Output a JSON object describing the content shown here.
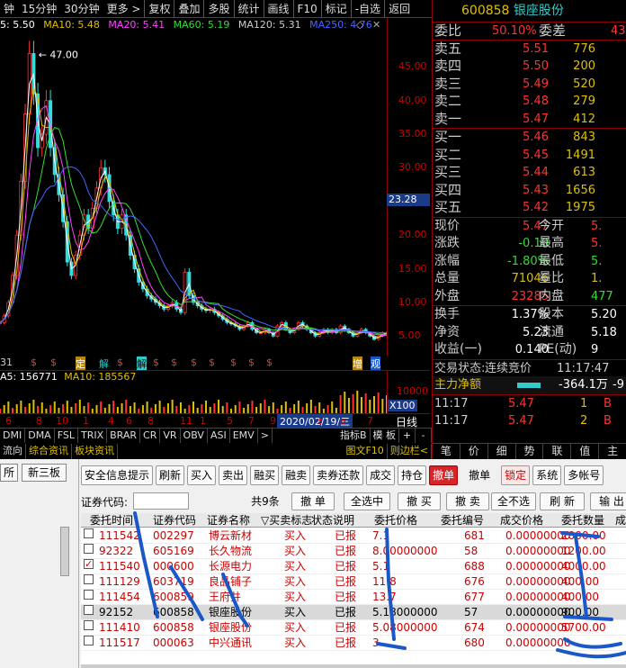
{
  "toolbar": {
    "periods": [
      "钟",
      "15分钟",
      "30分钟",
      "更多 >"
    ],
    "buttons": [
      "复权",
      "叠加",
      "多股",
      "统计",
      "画线",
      "F10",
      "标记",
      "-自选",
      "返回"
    ]
  },
  "ma_legend": {
    "ma5": "5: 5.50",
    "ma10": "MA10: 5.48",
    "ma20": "MA20: 5.41",
    "ma60": "MA60: 5.19",
    "ma120": "MA120: 5.31",
    "ma250": "MA250: 4.76",
    "colors": {
      "ma5": "#ffffff",
      "ma10": "#e0c000",
      "ma20": "#ff44ff",
      "ma60": "#33dd33",
      "ma120": "#cccccc",
      "ma250": "#4466ff"
    }
  },
  "chart_data": {
    "type": "line",
    "series": [
      {
        "values": [
          7,
          8,
          10,
          14,
          20,
          28,
          38,
          47,
          41,
          33,
          35,
          40,
          33,
          29,
          26,
          22,
          16,
          14,
          17,
          20,
          23,
          21,
          24,
          27,
          30,
          29,
          25,
          23,
          21,
          23,
          20,
          17,
          15,
          13,
          12,
          11,
          10.5,
          10,
          9.5,
          9,
          9.5,
          10,
          9,
          8.5,
          14.5,
          11,
          10,
          9.5,
          9,
          8.8,
          9,
          8.5,
          8,
          7.5,
          7,
          6.8,
          6.5,
          6,
          6.5,
          7,
          6,
          5.5,
          5.5,
          6,
          5.5,
          5,
          6.5,
          7,
          6,
          5.5,
          6,
          7,
          6.5,
          6,
          5.5,
          5,
          5.5,
          6,
          5.5,
          6,
          5.5,
          6.5,
          6,
          5.5,
          5,
          5.5,
          6,
          5.5,
          5,
          4.5,
          5,
          5.5,
          5.5
        ]
      }
    ],
    "ylim": [
      2.5,
      50
    ],
    "yticks": [
      "45.00",
      "40.00",
      "35.00",
      "30.00",
      "25.00",
      "20.00",
      "15.00",
      "10.00",
      "5.00"
    ],
    "high_label": "47.00",
    "current": "23.28",
    "grid": false
  },
  "signals": [
    {
      "t": "$",
      "c": "#ff3333"
    },
    {
      "t": "$",
      "c": "#ff3333"
    },
    {
      "t": "解",
      "c": "#33cccc"
    },
    {
      "t": "$",
      "c": "#ff3333"
    },
    {
      "t": "$",
      "c": "#ff3333"
    },
    {
      "t": "$",
      "c": "#ff3333"
    },
    {
      "t": "$",
      "c": "#ff3333"
    },
    {
      "t": "$",
      "c": "#ff3333"
    },
    {
      "t": "$",
      "c": "#ff3333"
    },
    {
      "t": "$",
      "c": "#ff3333"
    },
    {
      "t": "$",
      "c": "#ff3333"
    }
  ],
  "signal_extra": [
    "31",
    "定",
    "解",
    "增",
    "观"
  ],
  "volume": {
    "legend": [
      "A5: 156771",
      "MA10: 185567"
    ],
    "yticks": [
      "10000",
      "X100"
    ]
  },
  "date": {
    "ticks": [
      "6",
      "8",
      "10",
      "1",
      "4",
      "6",
      "8",
      "11",
      "1",
      "5",
      "7",
      "9",
      "3",
      "5",
      "7"
    ],
    "highlight": "2020/02/19/三",
    "label": "日线"
  },
  "bottom_tabs": {
    "row1": [
      "DMI",
      "DMA",
      "FSL",
      "TRIX",
      "BRAR",
      "CR",
      "VR",
      "OBV",
      "ASI",
      "EMV",
      ">"
    ],
    "row1_right": [
      "指标B",
      "模 板",
      "+",
      "-"
    ],
    "row2": [
      "流向",
      "综合资讯",
      "板块资讯"
    ],
    "row2_right": [
      "图文F10",
      "则边栏<"
    ]
  },
  "quote": {
    "code": "600858",
    "name": "银座股份",
    "weibi_label": "委比",
    "weibi": "50.10%",
    "weicha_label": "委差",
    "weicha": "43",
    "asks": [
      {
        "label": "卖五",
        "price": "5.51",
        "qty": "776"
      },
      {
        "label": "卖四",
        "price": "5.50",
        "qty": "200"
      },
      {
        "label": "卖三",
        "price": "5.49",
        "qty": "520"
      },
      {
        "label": "卖二",
        "price": "5.48",
        "qty": "279"
      },
      {
        "label": "卖一",
        "price": "5.47",
        "qty": "412"
      }
    ],
    "bids": [
      {
        "label": "买一",
        "price": "5.46",
        "qty": "843"
      },
      {
        "label": "买二",
        "price": "5.45",
        "qty": "1491"
      },
      {
        "label": "买三",
        "price": "5.44",
        "qty": "613"
      },
      {
        "label": "买四",
        "price": "5.43",
        "qty": "1656"
      },
      {
        "label": "买五",
        "price": "5.42",
        "qty": "1975"
      }
    ],
    "stats": [
      {
        "l": "现价",
        "v": "5.47",
        "vc": "red",
        "l2": "今开",
        "v2": "5.",
        "v2c": "red"
      },
      {
        "l": "涨跌",
        "v": "-0.10",
        "vc": "grn",
        "l2": "最高",
        "v2": "5.",
        "v2c": "red"
      },
      {
        "l": "涨幅",
        "v": "-1.80%",
        "vc": "grn",
        "l2": "最低",
        "v2": "5.",
        "v2c": "grn"
      },
      {
        "l": "总量",
        "v": "71046",
        "vc": "yel",
        "l2": "量比",
        "v2": "1.",
        "v2c": "yel"
      },
      {
        "l": "外盘",
        "v": "23285",
        "vc": "red",
        "l2": "内盘",
        "v2": "477",
        "v2c": "grn"
      }
    ],
    "stats2": [
      {
        "l": "换手",
        "v": "1.37%",
        "vc": "wht",
        "l2": "股本",
        "v2": "5.20",
        "v2c": "wht"
      },
      {
        "l": "净资",
        "v": "5.23",
        "vc": "wht",
        "l2": "流通",
        "v2": "5.18",
        "v2c": "wht"
      },
      {
        "l": "收益(一)",
        "v": "0.140",
        "vc": "wht",
        "l2": "PE(动)",
        "v2": "9",
        "v2c": "wht"
      }
    ],
    "status_label": "交易状态:",
    "status": "连续竞价",
    "status_time": "11:17:47",
    "netflow_label": "主力净额",
    "netflow": "-364.1万",
    "netflow_end": "-9",
    "ticks": [
      {
        "t": "11:17",
        "p": "5.47",
        "q": "1",
        "d": "B"
      },
      {
        "t": "11:17",
        "p": "5.47",
        "q": "2",
        "d": "B"
      }
    ],
    "tabs": [
      "笔",
      "价",
      "细",
      "势",
      "联",
      "值",
      "主"
    ]
  },
  "trade": {
    "left_tabs": [
      "所",
      "新三板"
    ],
    "buttons": [
      "安全信息提示",
      "刷新",
      "买入",
      "卖出",
      "融买",
      "融卖",
      "卖券还款",
      "成交",
      "持仓",
      "撤单",
      "撤单",
      "锁定",
      "系统",
      "多帐号"
    ],
    "active_button": "撤单",
    "code_label": "证券代码:",
    "count": "共9条",
    "cbtns": [
      "撤 单",
      "全选中",
      "撤 买",
      "撤 卖",
      "全不选",
      "刷 新",
      "输 出"
    ],
    "headers": [
      "委托时间",
      "证券代码",
      "证券名称",
      "▽买卖标志",
      "状态说明",
      "委托价格",
      "委托编号",
      "成交价格",
      "委托数量",
      "成"
    ],
    "rows": [
      {
        "checked": false,
        "time": "111542",
        "code": "002297",
        "name": "博云新材",
        "side": "买入",
        "status": "已报",
        "price": "7.1",
        "no": "681",
        "dprice": "0.00000000",
        "qty": "2000.00"
      },
      {
        "checked": false,
        "time": "92322",
        "code": "605169",
        "name": "长久物流",
        "side": "买入",
        "status": "已报",
        "price": "8.00000000",
        "no": "58",
        "dprice": "0.00000000",
        "qty": "1200.00"
      },
      {
        "checked": true,
        "time": "111540",
        "code": "000600",
        "name": "长源电力",
        "side": "买入",
        "status": "已报",
        "price": "5.1",
        "no": "688",
        "dprice": "0.00000000",
        "qty": "4000.00"
      },
      {
        "checked": false,
        "time": "111129",
        "code": "603719",
        "name": "良品铺子",
        "side": "买入",
        "status": "已报",
        "price": "11.8",
        "no": "676",
        "dprice": "0.00000000",
        "qty": "400.00"
      },
      {
        "checked": false,
        "time": "111454",
        "code": "600859",
        "name": "王府井",
        "side": "买入",
        "status": "已报",
        "price": "13.7",
        "no": "677",
        "dprice": "0.00000000",
        "qty": "400.00"
      },
      {
        "checked": false,
        "time": "92152",
        "code": "600858",
        "name": "银座股份",
        "side": "买入",
        "status": "已报",
        "price": "5.18000000",
        "no": "57",
        "dprice": "0.00000000",
        "qty": "900.00",
        "sel": true
      },
      {
        "checked": false,
        "time": "111410",
        "code": "600858",
        "name": "银座股份",
        "side": "买入",
        "status": "已报",
        "price": "5.08000000",
        "no": "674",
        "dprice": "0.00000000",
        "qty": "5700.00"
      },
      {
        "checked": false,
        "time": "111517",
        "code": "000063",
        "name": "中兴通讯",
        "side": "买入",
        "status": "已报",
        "price": "3",
        "no": "680",
        "dprice": "0.00000000",
        "qty": ""
      }
    ]
  }
}
